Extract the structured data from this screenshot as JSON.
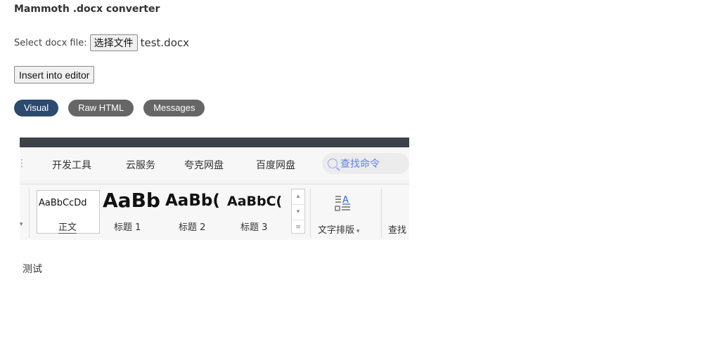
{
  "header": {
    "title": "Mammoth .docx converter"
  },
  "file_input": {
    "label": "Select docx file:",
    "button_label": "选择文件",
    "file_name": "test.docx"
  },
  "insert_button": {
    "label": "Insert into editor"
  },
  "tabs": [
    {
      "label": "Visual",
      "active": true
    },
    {
      "label": "Raw HTML",
      "active": false
    },
    {
      "label": "Messages",
      "active": false
    }
  ],
  "screenshot": {
    "menu": [
      "开发工具",
      "云服务",
      "夸克网盘",
      "百度网盘"
    ],
    "search_placeholder": "查找命令",
    "styles": [
      {
        "preview": "AaBbCcDd",
        "caption": "正文"
      },
      {
        "preview": "AaBb",
        "caption": "标题 1"
      },
      {
        "preview": "AaBb(",
        "caption": "标题 2"
      },
      {
        "preview": "AaBbC(",
        "caption": "标题 3"
      }
    ],
    "text_layout_label": "文字排版",
    "find_label": "查找"
  },
  "content": {
    "text": "测试"
  },
  "colors": {
    "active_tab": "#2c4a6e",
    "inactive_tab": "#666666",
    "screenshot_topbar": "#3d4249"
  }
}
